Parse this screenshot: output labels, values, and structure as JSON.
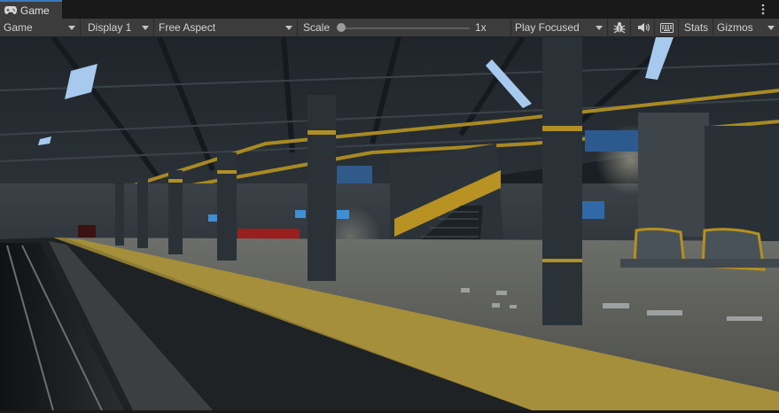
{
  "tab": {
    "title": "Game",
    "icon": "gamepad-icon"
  },
  "toolbar": {
    "view_mode": "Game",
    "display": "Display 1",
    "aspect": "Free Aspect",
    "scale_label": "Scale",
    "scale_value": "1x",
    "scale_level": 0,
    "play_mode": "Play Focused",
    "stats_label": "Stats",
    "gizmos_label": "Gizmos",
    "icons": [
      "bug-icon",
      "audio-icon",
      "keyboard-icon",
      "more-icon"
    ]
  },
  "colors": {
    "accent": "#3a79bb",
    "toolbar_bg": "#3c3c3c",
    "tab_bg": "#3c3c3c",
    "panel_bg": "#191919"
  }
}
